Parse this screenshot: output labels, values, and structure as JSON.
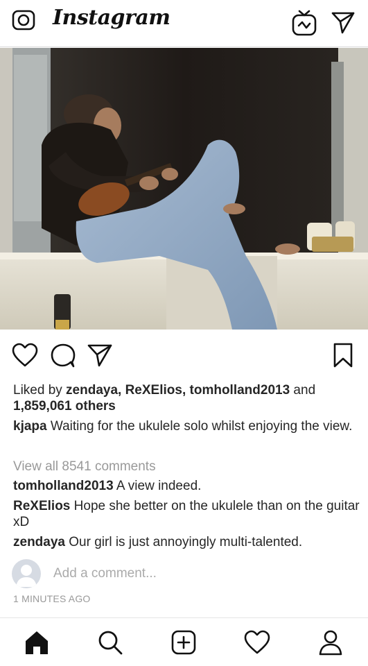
{
  "header": {
    "brand": "Instagram"
  },
  "post": {
    "likes": {
      "prefix": "Liked by ",
      "users": "zendaya, ReXElios, tomholland2013",
      "and_word": " and",
      "others": "1,859,061 others"
    },
    "caption": {
      "user": "kjapa",
      "text": " Waiting for the ukulele solo whilst enjoying the view."
    },
    "view_all_comments": "View all 8541 comments",
    "comments": [
      {
        "user": "tomholland2013",
        "text": " A view indeed."
      },
      {
        "user": "ReXElios",
        "text": " Hope she better on the ukulele than on the guitar xD"
      },
      {
        "user": "zendaya",
        "text": " Our girl is just annoyingly multi-talented."
      }
    ],
    "add_comment_placeholder": "Add a comment...",
    "timestamp": "1 MINUTES AGO"
  },
  "icons": {
    "top": [
      "camera-icon",
      "igtv-icon",
      "direct-message-icon"
    ],
    "actions": [
      "like-heart-icon",
      "comment-icon",
      "share-icon",
      "bookmark-icon"
    ],
    "bottom_nav": [
      "home-icon",
      "search-icon",
      "add-post-icon",
      "activity-heart-icon",
      "profile-icon"
    ]
  },
  "colors": {
    "text": "#262626",
    "muted": "#999999",
    "placeholder": "#aaaaaa",
    "divider": "#dbdbdb"
  }
}
